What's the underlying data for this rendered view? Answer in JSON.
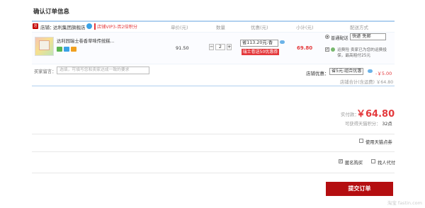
{
  "page": {
    "title": "确认订单信息"
  },
  "columns": [
    "单价(元)",
    "数量",
    "优惠(元)",
    "小计(元)",
    "配送方式"
  ],
  "shop": {
    "label": "店铺：",
    "name": "达利集团旗舰店",
    "vip_text": "店铺VIP3-否2倍积分"
  },
  "item": {
    "name": "达利园瑞士卷香草味传统糕...",
    "unit_price": "91.50",
    "quantity": "2",
    "discount_select": "省113.20元:香",
    "promo_tag": "瑞士卷送50优惠券",
    "subtotal": "69.80"
  },
  "shipping": {
    "label": "普通配送",
    "option": "快递 免邮",
    "insurance_text": "运费险 卖家已为您的运费投保，最高赔付25元"
  },
  "message": {
    "label": "买家留言：",
    "placeholder": "选填，可填写您和卖家达成一致的要求"
  },
  "shop_discount": {
    "label": "店铺优惠：",
    "option": "省5元:组合优惠",
    "value": "-￥5.00"
  },
  "shop_total": "店铺合计(含运费) ￥64.80",
  "payment": {
    "paid_label": "实付款：",
    "paid_amount": "￥64.80",
    "points_label": "可获得天猫积分：",
    "points_value": "32点"
  },
  "options": {
    "tmall_points": "使用天猫点券",
    "anonymous": "匿名购买",
    "proxy": "找人代付"
  },
  "submit_label": "提交订单",
  "watermark": "淘宝 fastin.com"
}
